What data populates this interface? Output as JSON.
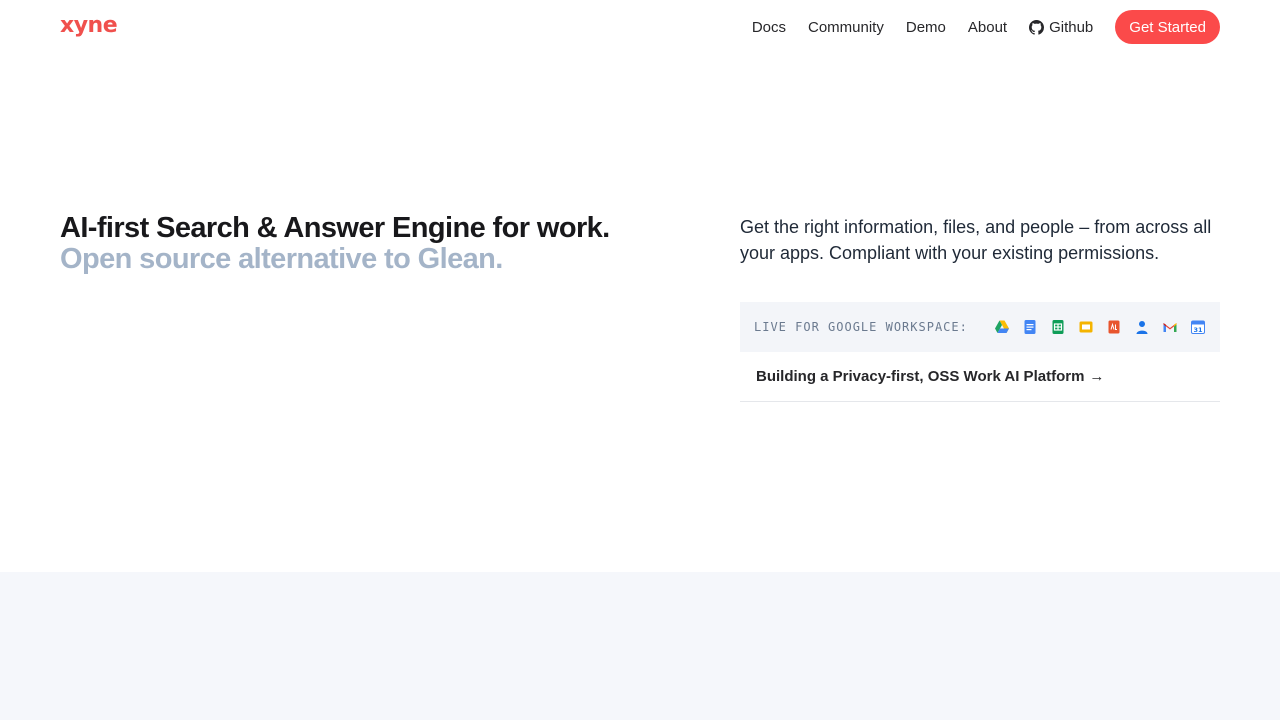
{
  "brand": {
    "logo_text": "xyne",
    "accent": "#f0504d"
  },
  "nav": {
    "links": [
      "Docs",
      "Community",
      "Demo",
      "About"
    ],
    "github_label": "Github",
    "cta_label": "Get Started",
    "cta_color": "#fb4a4a"
  },
  "hero": {
    "headline": "AI-first Search & Answer Engine for work.",
    "subheadline": "Open source alternative to Glean.",
    "description": "Get the right information, files, and people – from across all your apps. Compliant with your existing permissions.",
    "workspace_label": "LIVE FOR GOOGLE WORKSPACE:",
    "apps": [
      "google-drive-icon",
      "google-docs-icon",
      "google-sheets-icon",
      "google-slides-icon",
      "pdf-icon",
      "contacts-icon",
      "gmail-icon",
      "google-calendar-icon"
    ],
    "privacy_link": "Building a Privacy-first, OSS Work AI Platform",
    "privacy_arrow": "→"
  }
}
